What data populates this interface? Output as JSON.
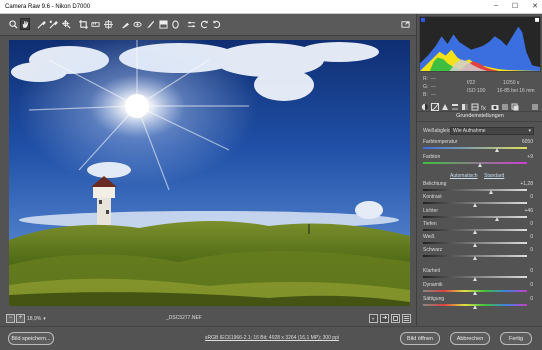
{
  "window": {
    "title": "Camera Raw 9.6  -  Nikon D7000",
    "min": "–",
    "max": "☐",
    "close": "✕"
  },
  "status": {
    "zoom": "18,9%",
    "filename": "_DSC5277.NEF"
  },
  "footer": {
    "save_button": "Bild speichern...",
    "workflow_info": "sRGB IEC61966-2.1; 16 Bit; 4928 x 3264 (16,1 MP); 300 ppi",
    "open_button": "Bild öffnen",
    "cancel_button": "Abbrechen",
    "done_button": "Fertig"
  },
  "meta": {
    "r": "R:",
    "g": "G:",
    "b": "B:",
    "r_val": "---",
    "g_val": "---",
    "b_val": "---",
    "aperture": "f/22",
    "shutter": "1/250 s",
    "iso": "ISO 100",
    "focal": "16-85 bei 16 mm"
  },
  "panel": {
    "section_title": "Grundeinstellungen",
    "wb_label": "Weißabgleich:",
    "wb_value": "Wie Aufnahme",
    "auto_link": "Automatisch",
    "default_link": "Standard"
  },
  "sliders": [
    {
      "label": "Farbtemperatur",
      "value": "6050",
      "pos": 0.72,
      "track": "temp"
    },
    {
      "label": "Farbton",
      "value": "+9",
      "pos": 0.55,
      "track": "tint"
    },
    {
      "label": "Belichtung",
      "value": "+1,28",
      "pos": 0.66,
      "track": "gray"
    },
    {
      "label": "Kontrast",
      "value": "0",
      "pos": 0.5,
      "track": "gray"
    },
    {
      "label": "Lichter",
      "value": "+46",
      "pos": 0.72,
      "track": "gray"
    },
    {
      "label": "Tiefen",
      "value": "0",
      "pos": 0.5,
      "track": "gray"
    },
    {
      "label": "Weiß",
      "value": "0",
      "pos": 0.5,
      "track": "gray"
    },
    {
      "label": "Schwarz",
      "value": "0",
      "pos": 0.5,
      "track": "gray"
    },
    {
      "label": "Klarheit",
      "value": "0",
      "pos": 0.5,
      "track": "gray"
    },
    {
      "label": "Dynamik",
      "value": "0",
      "pos": 0.5,
      "track": "sat"
    },
    {
      "label": "Sättigung",
      "value": "0",
      "pos": 0.5,
      "track": "sat"
    }
  ],
  "colors": {
    "background": "#535353",
    "sky": "#1f4d9e",
    "grass": "#5f7a1a"
  }
}
